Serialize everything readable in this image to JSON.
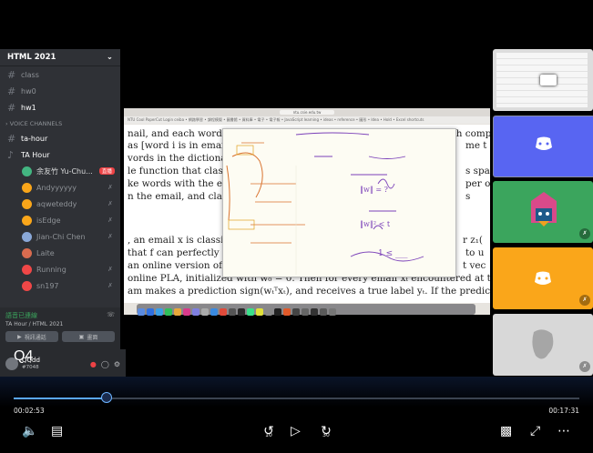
{
  "server": {
    "name": "HTML 2021",
    "chevron": "chevron-down-icon"
  },
  "channels": [
    {
      "name": "class"
    },
    {
      "name": "hw0"
    },
    {
      "name": "hw1"
    }
  ],
  "voice_category": "VOICE CHANNELS",
  "voice_channels": [
    {
      "name": "ta-hour"
    },
    {
      "name": "TA Hour"
    }
  ],
  "voice_users": [
    {
      "name": "余友竹 Yu-Chu...",
      "badge": "直播",
      "color": "#43b581"
    },
    {
      "name": "Andyyyyyy",
      "color": "#faa61a"
    },
    {
      "name": "aqweteddy",
      "color": "#faa61a"
    },
    {
      "name": "isEdge",
      "color": "#faa61a"
    },
    {
      "name": "Jian-Chi Chen",
      "color": "#8aa8d8"
    },
    {
      "name": "Laite",
      "color": "#d96b4f"
    },
    {
      "name": "Running",
      "color": "#f04747"
    },
    {
      "name": "sn197",
      "color": "#f04747"
    }
  ],
  "voice_status": {
    "connected": "語音已連線",
    "location": "TA Hour / HTML 2021",
    "btn_video": "視訊通話",
    "btn_screen": "畫面"
  },
  "user": {
    "name": "QQdd",
    "tag": "#7048"
  },
  "overlay_label": "Q4",
  "paper_lines": [
    "nail, and each word belongs to a big dictionary of size d > m. The i-th componen",
    "as [word i is in email",
    "vords in the dictionary",
    "le function that classifi",
    "ke words with the em",
    "n the email, and classif",
    ", an email x is classifie",
    "that f can perfectly",
    "an online version of P",
    "online PLA, initialized with w₀ = 0. Then for every email xₜ encountered at time",
    "am makes a prediction sign(wₜᵀxₜ), and receives a true label yₜ. If the prediction is i"
  ],
  "paper_right": [
    "me t",
    "s spa",
    "per o",
    "s",
    "r z₁(",
    "to u",
    "t vec"
  ],
  "note_text": {
    "eq1": "‖w‖ = ?",
    "eq2": "‖w‖² < t",
    "eq3": "1 ≤ ___"
  },
  "browser": {
    "url": "ntu.csie.edu.tw",
    "bookmarks": "NTU Cool  PaperCut Login  ceiba  • 網路學習  • 課程模擬  • 圖書館  • 資料庫  • 電子  • 電子報  • JavaScript learning  • ideas  • reference  • 圖形  • Idea  • Hold  • Excel shortcuts"
  },
  "player": {
    "current": "00:02:53",
    "total": "00:17:31",
    "progress": 0.165,
    "skip_back": "10",
    "skip_fwd": "30"
  },
  "colors": {
    "accent": "#5aa7ff",
    "discord": "#5865f2"
  }
}
